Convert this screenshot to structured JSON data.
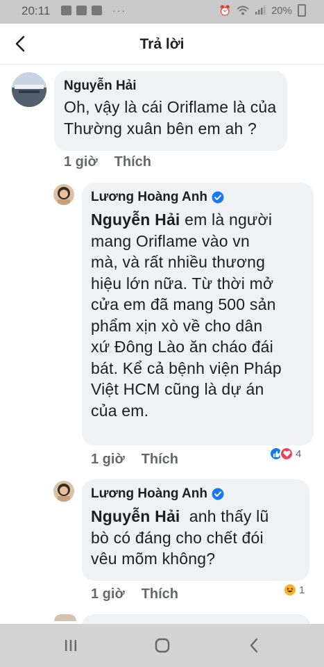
{
  "status_bar": {
    "time": "20:11",
    "dots": "···",
    "battery": "20%"
  },
  "header": {
    "title": "Trả lời"
  },
  "comments": [
    {
      "author": "Nguyễn Hải",
      "text_lines": [
        "Oh, vậy là cái Oriflame là của",
        "Thường xuân bên em ah ?"
      ],
      "time": "1 giờ",
      "like_label": "Thích"
    },
    {
      "author": "Lương Hoàng Anh",
      "verified": true,
      "mention": "Nguyễn Hải",
      "text_first": " em là người",
      "text_lines": [
        "mang Oriflame vào vn",
        "mà, và rất nhiều thương",
        "hiệu lớn nữa. Từ thời mở",
        "cửa em đã mang 500 sản",
        "phẩm xịn xò về cho dân",
        "xứ Đông Lào ăn cháo đái",
        "bát. Kể cả bệnh viện Pháp",
        "Việt HCM cũng là dự án",
        "của em."
      ],
      "time": "1 giờ",
      "like_label": "Thích",
      "reactions": {
        "types": [
          "like",
          "love"
        ],
        "count": "4"
      }
    },
    {
      "author": "Lương Hoàng Anh",
      "verified": true,
      "mention": "Nguyễn Hải",
      "text_first": "  anh thấy lũ",
      "text_lines": [
        "bò có đáng cho chết đói",
        "vêu mõm không?"
      ],
      "time": "1 giờ",
      "like_label": "Thích",
      "reactions": {
        "types": [
          "haha"
        ],
        "count": "1"
      }
    }
  ],
  "icons": {
    "back": "back-arrow-icon",
    "verified": "verified-badge-icon",
    "nav": [
      "recent-apps-icon",
      "home-icon",
      "nav-back-icon"
    ]
  },
  "colors": {
    "bubble": "#eff1f4",
    "meta_text": "#65676b",
    "verified": "#1877f2",
    "love": "#f33e58",
    "like": "#1877f2",
    "haha": "#f7b125"
  }
}
